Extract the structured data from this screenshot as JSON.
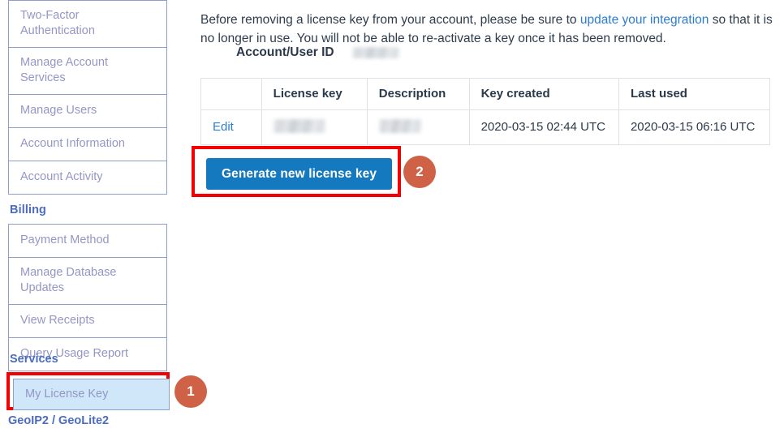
{
  "sidebar": {
    "groups": [
      {
        "items": [
          {
            "label": "Two-Factor Authentication",
            "two_line": true
          },
          {
            "label": "Manage Account Services",
            "two_line": true
          },
          {
            "label": "Manage Users",
            "two_line": false
          },
          {
            "label": "Account Information",
            "two_line": false
          },
          {
            "label": "Account Activity",
            "two_line": false
          }
        ]
      },
      {
        "heading": "Billing",
        "items": [
          {
            "label": "Payment Method",
            "two_line": false
          },
          {
            "label": "Manage Database Updates",
            "two_line": true
          },
          {
            "label": "View Receipts",
            "two_line": false
          },
          {
            "label": "Query Usage Report",
            "two_line": false
          }
        ]
      }
    ],
    "services_heading": "Services",
    "selected_item": "My License Key",
    "footer_link": "GeoIP2 / GeoLite2"
  },
  "callouts": {
    "step_one": "1",
    "step_two": "2",
    "highlight_color": "#f50000",
    "badge_color": "#cf6146"
  },
  "main": {
    "intro": {
      "before_link": "Before removing a license key from your account, please be sure to ",
      "link_text": "update your integration",
      "after_link": " so that it is no longer in use. You will not be able to re-activate a key once it has been removed."
    },
    "account": {
      "label": "Account/User ID",
      "value": ""
    },
    "table": {
      "headers": [
        "",
        "License key",
        "Description",
        "Key created",
        "Last used"
      ],
      "rows": [
        {
          "action": "Edit",
          "license_key": "",
          "description": "",
          "key_created": "2020-03-15 02:44 UTC",
          "last_used": "2020-03-15 06:16 UTC"
        }
      ]
    },
    "generate_button": "Generate new license key",
    "accent_color": "#1579bf",
    "link_color": "#2b7cd3"
  }
}
